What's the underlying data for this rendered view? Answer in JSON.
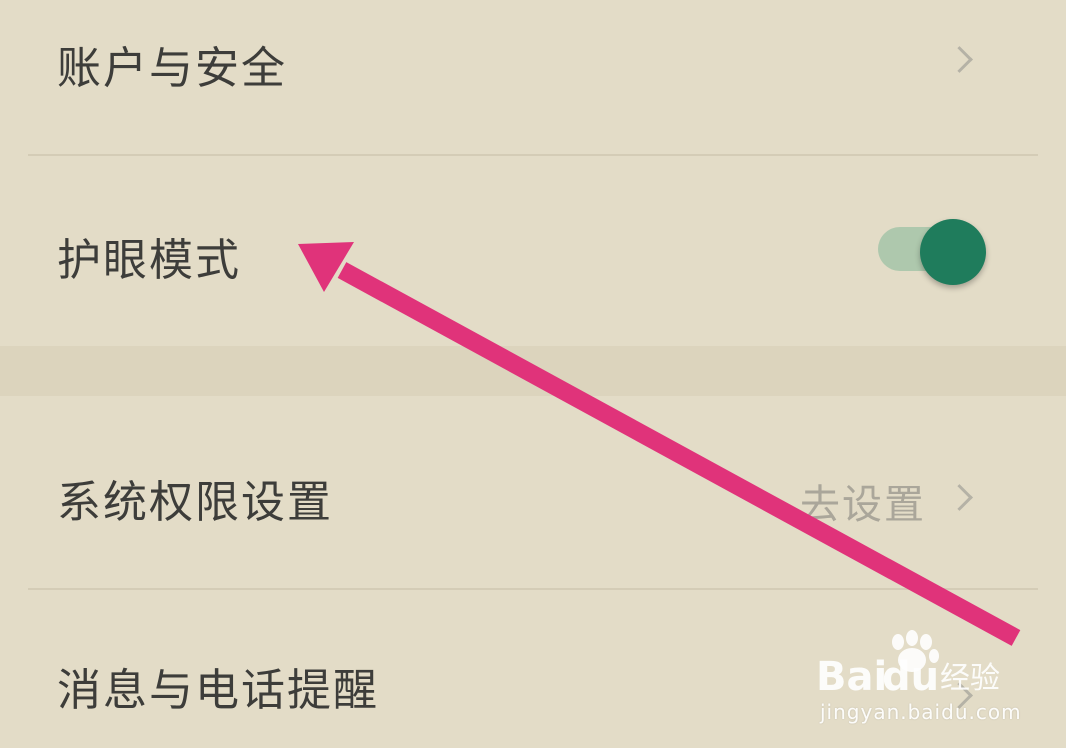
{
  "settings": {
    "account_security": {
      "label": "账户与安全"
    },
    "eye_care_mode": {
      "label": "护眼模式",
      "enabled": true
    },
    "system_permissions": {
      "label": "系统权限设置",
      "value": "去设置"
    },
    "message_call_reminders": {
      "label": "消息与电话提醒"
    }
  },
  "watermark": {
    "logo_text": "Baidu经验",
    "url": "jingyan.baidu.com"
  },
  "colors": {
    "background": "#e3dcc7",
    "toggle_on": "#1f7c5c",
    "annotation_arrow": "#e0337a"
  },
  "icons": {
    "chevron": "chevron-right-icon",
    "arrow": "annotation-arrow"
  }
}
